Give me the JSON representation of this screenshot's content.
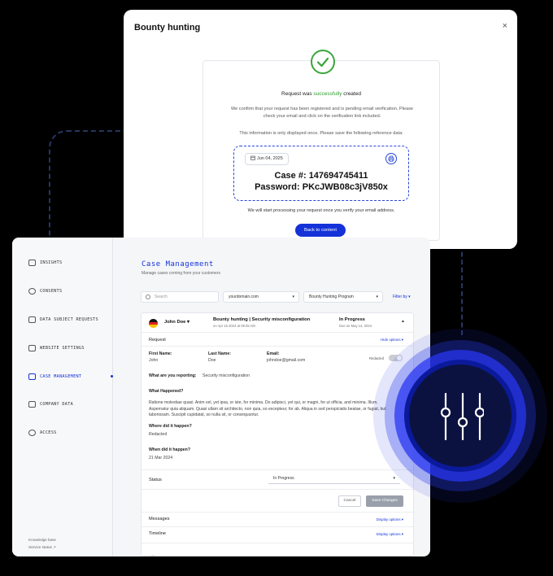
{
  "modal": {
    "title": "Bounty hunting",
    "close": "×",
    "status_prefix": "Request was ",
    "status_highlight": "successfully",
    "status_suffix": " created",
    "confirm_text": "We confirm that your request has been registered and is pending email verification. Please check your email and click on the verification link included.",
    "info_once": "This information is only displayed once. Please save the following reference data:",
    "date": "Jun 04, 2025",
    "case_number": "Case #: 147694745411",
    "password": "Password: PKcJWB08c3jV850x",
    "processing_note": "We will start processing your request once you verify your email address.",
    "back_button": "Back to content"
  },
  "sidebar": {
    "items": [
      {
        "label": "INSIGHTS",
        "icon": "insights-icon"
      },
      {
        "label": "CONSENTS",
        "icon": "consents-icon"
      },
      {
        "label": "DATA SUBJECT REQUESTS",
        "icon": "data-subject-requests-icon"
      },
      {
        "label": "WEBSITE SETTINGS",
        "icon": "website-settings-icon"
      },
      {
        "label": "CASE MANAGEMENT",
        "icon": "case-management-icon"
      },
      {
        "label": "COMPANY DATA",
        "icon": "company-data-icon"
      },
      {
        "label": "ACCESS",
        "icon": "access-icon"
      }
    ],
    "active_index": 4,
    "footer": [
      "Knowledge base",
      "Service status ↗"
    ]
  },
  "main": {
    "title": "Case Management",
    "subtitle": "Manage cases coming from your customers",
    "search_placeholder": "Search",
    "filter_domain": "yourdomain.com",
    "filter_program": "Bounty Hunting Program",
    "filter_by": "Filter by ▾"
  },
  "case": {
    "person": "John Doe",
    "title": "Bounty hunting | Security misconfiguration",
    "meta": "on Apr 16 2024 at 09:35 AM",
    "status": "In Progress",
    "status_meta": "Due on May 14, 2024",
    "request_label": "Request",
    "hide_options": "Hide options",
    "first_name_label": "First Name:",
    "first_name": "John",
    "last_name_label": "Last Name:",
    "last_name": "Doe",
    "email_label": "Email:",
    "email": "johndoe@gmail.com",
    "redacted_toggle": "Redacted",
    "reporting_label": "What are you reporting:",
    "reporting_value": "Security misconfiguration",
    "what_happened_label": "What Happened?",
    "what_happened_text": "Ratione molestiae quasi. Anim vel, yet ipsa, or iste, for minima. Do adipisci, yet qui, or magni, for ut officia, and minima. Illum. Aspernatur quia aliquam. Quasi ullam sit architecto, non quia, so excepteur, for ab. Aliqua in sed perspiciatis beatae, or fugiat, but laboriosam. Suscipit cupidatat, so nulla sit, or consequuntur.",
    "where_label": "Where did it happen?",
    "where_value": "Redacted",
    "when_label": "When did it happen?",
    "when_value": "21 Mar 2024",
    "status_label": "Status",
    "status_select": "In Progress",
    "cancel": "Cancel",
    "save": "Save Changes",
    "messages_label": "Messages",
    "timeline_label": "Timeline",
    "display_options": "Display options"
  },
  "colors": {
    "accent": "#1432d8",
    "success": "#3aa63a",
    "glow_core": "#0c1240"
  }
}
